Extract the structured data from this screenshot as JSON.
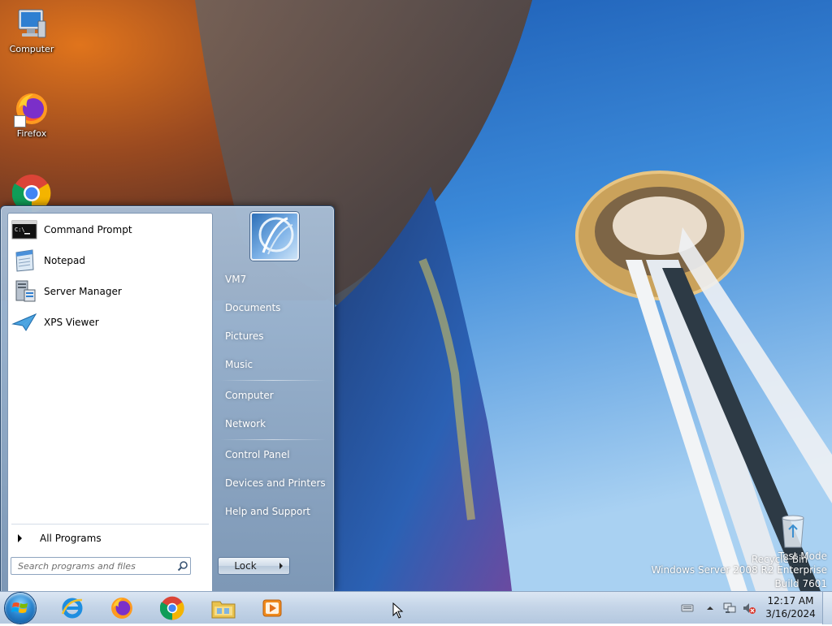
{
  "desktop": {
    "icons": [
      {
        "label": "Computer",
        "icon": "computer-icon"
      },
      {
        "label": "Firefox",
        "icon": "firefox-icon"
      },
      {
        "label": "Google Chrome",
        "icon": "chrome-icon"
      },
      {
        "label": "Recycle Bin",
        "icon": "recycle-bin-icon"
      }
    ],
    "system_text": {
      "line1": "Test Mode",
      "line2": "Windows Server 2008 R2 Enterprise",
      "line3": "Build 7601"
    }
  },
  "start_menu": {
    "programs": [
      {
        "label": "Command Prompt",
        "icon": "command-prompt-icon"
      },
      {
        "label": "Notepad",
        "icon": "notepad-icon"
      },
      {
        "label": "Server Manager",
        "icon": "server-manager-icon"
      },
      {
        "label": "XPS Viewer",
        "icon": "xps-viewer-icon"
      }
    ],
    "all_programs": "All Programs",
    "search_placeholder": "Search programs and files",
    "right_items": [
      {
        "label": "VM7"
      },
      {
        "label": "Documents"
      },
      {
        "label": "Pictures"
      },
      {
        "label": "Music"
      },
      {
        "label": "Computer"
      },
      {
        "label": "Network"
      },
      {
        "label": "Control Panel"
      },
      {
        "label": "Devices and Printers"
      },
      {
        "label": "Help and Support"
      }
    ],
    "lock_label": "Lock"
  },
  "taskbar": {
    "pinned": [
      "internet-explorer-icon",
      "firefox-icon",
      "chrome-icon",
      "windows-explorer-icon",
      "media-player-icon"
    ],
    "clock_time": "12:17 AM",
    "clock_date": "3/16/2024"
  },
  "colors": {
    "taskbar": "#c5d5e8",
    "start_menu_glass": "#8fa9c6",
    "sky": "#3a86d8"
  }
}
